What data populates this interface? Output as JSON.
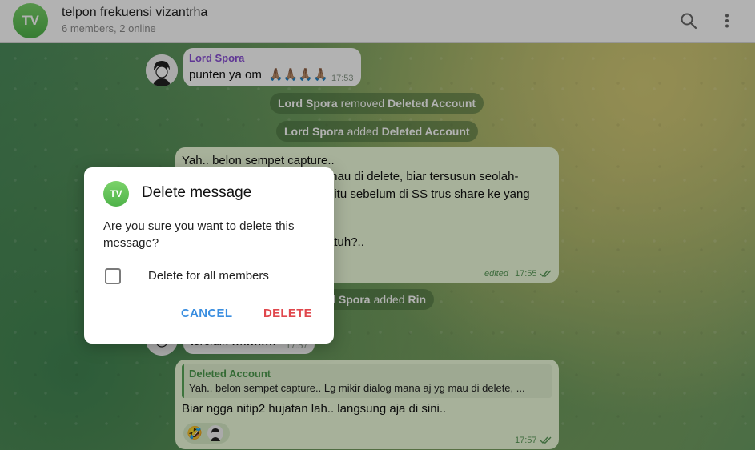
{
  "header": {
    "avatar_initials": "TV",
    "title": "telpon frekuensi vizantrha",
    "subtitle": "6 members, 2 online",
    "search_icon": "search-icon",
    "menu_icon": "more-vertical-icon"
  },
  "messages": {
    "m1": {
      "sender": "Lord Spora",
      "text": "punten ya om",
      "emoji": "🙏🏽🙏🏽🙏🏽🙏🏽",
      "time": "17:53"
    },
    "s1": {
      "actor": "Lord Spora",
      "action": "removed",
      "target": "Deleted Account"
    },
    "s2": {
      "actor": "Lord Spora",
      "action": "added",
      "target": "Deleted Account"
    },
    "m2": {
      "line1": "Yah.. belon sempet capture..",
      "line2": "mau di delete, biar tersusun seolah-",
      "line3": "gitu sebelum di SS trus share ke yang",
      "line4": "atuh?..",
      "edited": "edited",
      "time": "17:55"
    },
    "s3": {
      "actor": "rd Spora",
      "action": "added",
      "target": "Rin"
    },
    "m3": {
      "text": "tercidik wkwkwk",
      "time": "17:57"
    },
    "m4": {
      "reply_name": "Deleted Account",
      "reply_text": "Yah.. belon sempet capture.. Lg mikir dialog mana aj yg mau di delete, ...",
      "text": "Biar ngga nitip2 hujatan lah.. langsung aja di sini..",
      "reaction_emoji": "🤣",
      "time": "17:57"
    }
  },
  "dialog": {
    "avatar_initials": "TV",
    "title": "Delete message",
    "text": "Are you sure you want to delete this message?",
    "checkbox_label": "Delete for all members",
    "checkbox_checked": false,
    "cancel_label": "CANCEL",
    "delete_label": "DELETE",
    "cancel_color": "#3a8ee0",
    "delete_color": "#e0474c"
  }
}
